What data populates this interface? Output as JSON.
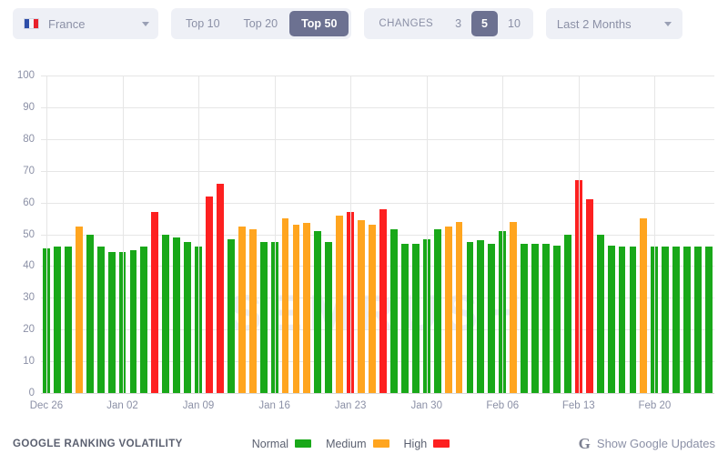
{
  "toolbar": {
    "country": {
      "name": "France",
      "flag_icon": "flag-france-icon",
      "caret_icon": "chevron-down-icon"
    },
    "top_group": {
      "options": [
        "Top 10",
        "Top 20",
        "Top 50"
      ],
      "selected": "Top 50"
    },
    "changes_group": {
      "label": "CHANGES",
      "options": [
        "3",
        "5",
        "10"
      ],
      "selected": "5"
    },
    "period": {
      "value": "Last 2 Months",
      "caret_icon": "chevron-down-icon"
    }
  },
  "footer": {
    "title": "GOOGLE RANKING VOLATILITY",
    "legend": [
      {
        "label": "Normal",
        "color": "#19a819"
      },
      {
        "label": "Medium",
        "color": "#ffa51f"
      },
      {
        "label": "High",
        "color": "#fd2020"
      }
    ],
    "google_updates": {
      "label": "Show Google Updates",
      "icon": "google-g-icon"
    }
  },
  "watermark": "SEMRUSH",
  "chart_data": {
    "type": "bar",
    "title": "GOOGLE RANKING VOLATILITY",
    "xlabel": "",
    "ylabel": "",
    "ylim": [
      0,
      100
    ],
    "yticks": [
      0,
      10,
      20,
      30,
      40,
      50,
      60,
      70,
      80,
      90,
      100
    ],
    "grid": true,
    "legend_position": "bottom",
    "colors": {
      "Normal": "#19a819",
      "Medium": "#ffa51f",
      "High": "#fd2020"
    },
    "xtick_labels": [
      "Dec 26",
      "Jan 02",
      "Jan 09",
      "Jan 16",
      "Jan 23",
      "Jan 30",
      "Feb 06",
      "Feb 13",
      "Feb 20"
    ],
    "xtick_indices": [
      0,
      7,
      14,
      21,
      28,
      35,
      42,
      49,
      56
    ],
    "categories": [
      "Dec 26",
      "Dec 27",
      "Dec 28",
      "Dec 29",
      "Dec 30",
      "Dec 31",
      "Jan 01",
      "Jan 02",
      "Jan 03",
      "Jan 04",
      "Jan 05",
      "Jan 06",
      "Jan 07",
      "Jan 08",
      "Jan 09",
      "Jan 10",
      "Jan 11",
      "Jan 12",
      "Jan 13",
      "Jan 14",
      "Jan 15",
      "Jan 16",
      "Jan 17",
      "Jan 18",
      "Jan 19",
      "Jan 20",
      "Jan 21",
      "Jan 22",
      "Jan 23",
      "Jan 24",
      "Jan 25",
      "Jan 26",
      "Jan 27",
      "Jan 28",
      "Jan 29",
      "Jan 30",
      "Jan 31",
      "Feb 01",
      "Feb 02",
      "Feb 03",
      "Feb 04",
      "Feb 05",
      "Feb 06",
      "Feb 07",
      "Feb 08",
      "Feb 09",
      "Feb 10",
      "Feb 11",
      "Feb 12",
      "Feb 13",
      "Feb 14",
      "Feb 15",
      "Feb 16",
      "Feb 17",
      "Feb 18",
      "Feb 19",
      "Feb 20",
      "Feb 21",
      "Feb 22",
      "Feb 23",
      "Feb 24",
      "Feb 25"
    ],
    "values": [
      45.5,
      46.0,
      46.0,
      52.5,
      50.0,
      46.0,
      44.5,
      44.5,
      45.0,
      46.0,
      57.0,
      50.0,
      49.0,
      47.5,
      46.0,
      62.0,
      66.0,
      48.5,
      52.5,
      51.5,
      47.5,
      47.5,
      55.0,
      53.0,
      53.5,
      51.0,
      47.5,
      56.0,
      57.0,
      54.5,
      53.0,
      58.0,
      51.5,
      47.0,
      47.0,
      48.5,
      51.5,
      52.5,
      54.0,
      47.5,
      48.0,
      47.0,
      51.0,
      54.0,
      47.0,
      47.0,
      47.0,
      46.5,
      50.0,
      67.0,
      61.0,
      50.0,
      46.5,
      46.0,
      46.0,
      55.0,
      46.0,
      46.0,
      46.0,
      46.0,
      46.0,
      46.0
    ],
    "levels": [
      "Normal",
      "Normal",
      "Normal",
      "Medium",
      "Normal",
      "Normal",
      "Normal",
      "Normal",
      "Normal",
      "Normal",
      "High",
      "Normal",
      "Normal",
      "Normal",
      "Normal",
      "High",
      "High",
      "Normal",
      "Medium",
      "Medium",
      "Normal",
      "Normal",
      "Medium",
      "Medium",
      "Medium",
      "Normal",
      "Normal",
      "Medium",
      "High",
      "Medium",
      "Medium",
      "High",
      "Normal",
      "Normal",
      "Normal",
      "Normal",
      "Normal",
      "Medium",
      "Medium",
      "Normal",
      "Normal",
      "Normal",
      "Normal",
      "Medium",
      "Normal",
      "Normal",
      "Normal",
      "Normal",
      "Normal",
      "High",
      "High",
      "Normal",
      "Normal",
      "Normal",
      "Normal",
      "Medium",
      "Normal",
      "Normal",
      "Normal",
      "Normal",
      "Normal",
      "Normal"
    ]
  }
}
